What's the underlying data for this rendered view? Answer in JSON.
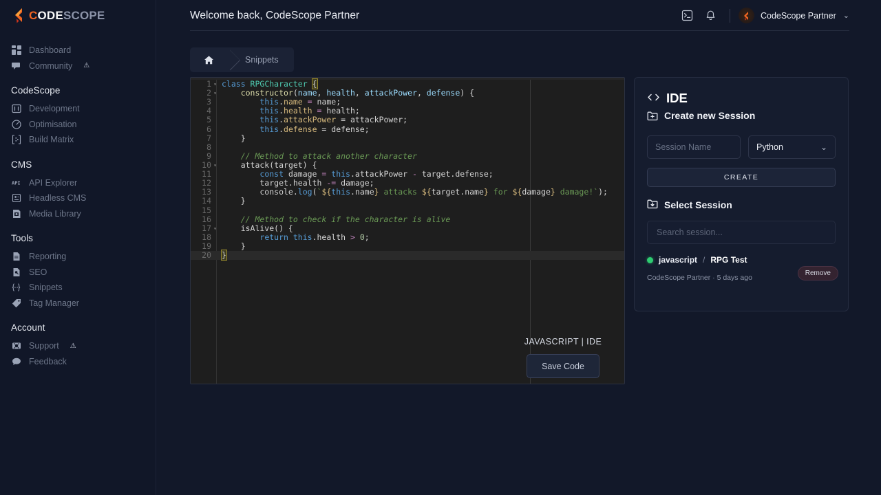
{
  "brand": {
    "part1": "C",
    "part2": "ODE",
    "part3": "SCOPE",
    "accent": "#f26522"
  },
  "sidebar": {
    "groups": [
      {
        "title": "",
        "items": [
          {
            "label": "Dashboard",
            "icon": "dashboard-icon",
            "warn": ""
          },
          {
            "label": "Community",
            "icon": "community-icon",
            "warn": "⚠"
          }
        ]
      },
      {
        "title": "CodeScope",
        "items": [
          {
            "label": "Development",
            "icon": "development-icon",
            "warn": ""
          },
          {
            "label": "Optimisation",
            "icon": "optimisation-icon",
            "warn": ""
          },
          {
            "label": "Build Matrix",
            "icon": "build-matrix-icon",
            "warn": ""
          }
        ]
      },
      {
        "title": "CMS",
        "items": [
          {
            "label": "API Explorer",
            "icon": "api-explorer-icon",
            "warn": ""
          },
          {
            "label": "Headless CMS",
            "icon": "headless-cms-icon",
            "warn": ""
          },
          {
            "label": "Media Library",
            "icon": "media-library-icon",
            "warn": ""
          }
        ]
      },
      {
        "title": "Tools",
        "items": [
          {
            "label": "Reporting",
            "icon": "reporting-icon",
            "warn": ""
          },
          {
            "label": "SEO",
            "icon": "seo-icon",
            "warn": ""
          },
          {
            "label": "Snippets",
            "icon": "snippets-icon",
            "warn": ""
          },
          {
            "label": "Tag Manager",
            "icon": "tag-manager-icon",
            "warn": ""
          }
        ]
      },
      {
        "title": "Account",
        "items": [
          {
            "label": "Support",
            "icon": "support-icon",
            "warn": "⚠"
          },
          {
            "label": "Feedback",
            "icon": "feedback-icon",
            "warn": ""
          }
        ]
      }
    ]
  },
  "header": {
    "welcome": "Welcome back, CodeScope Partner",
    "terminal_icon": "terminal-icon",
    "bell_icon": "bell-icon",
    "user_name": "CodeScope Partner",
    "caret": "⌄"
  },
  "breadcrumb": {
    "home_icon": "home-icon",
    "current": "Snippets"
  },
  "editor": {
    "language_label": "JAVASCRIPT | IDE",
    "save_label": "Save Code",
    "lines": [
      {
        "n": "1",
        "fold": "▾",
        "tokens": [
          {
            "t": "class ",
            "c": "k"
          },
          {
            "t": "RPGCharacter ",
            "c": "cl"
          },
          {
            "t": "{",
            "c": "br-hl"
          }
        ]
      },
      {
        "n": "2",
        "fold": "▾",
        "tokens": [
          {
            "t": "    constructor",
            "c": "fn"
          },
          {
            "t": "(",
            "c": "op"
          },
          {
            "t": "name",
            "c": "id"
          },
          {
            "t": ", ",
            "c": "op"
          },
          {
            "t": "health",
            "c": "id"
          },
          {
            "t": ", ",
            "c": "op"
          },
          {
            "t": "attackPower",
            "c": "id"
          },
          {
            "t": ", ",
            "c": "op"
          },
          {
            "t": "defense",
            "c": "id"
          },
          {
            "t": ") {",
            "c": "op"
          }
        ]
      },
      {
        "n": "3",
        "fold": "",
        "tokens": [
          {
            "t": "        ",
            "c": "op"
          },
          {
            "t": "this",
            "c": "k"
          },
          {
            "t": ".",
            "c": "op"
          },
          {
            "t": "name",
            "c": "yl"
          },
          {
            "t": " ",
            "c": "op"
          },
          {
            "t": "=",
            "c": "pk"
          },
          {
            "t": " name;",
            "c": "op"
          }
        ]
      },
      {
        "n": "4",
        "fold": "",
        "tokens": [
          {
            "t": "        ",
            "c": "op"
          },
          {
            "t": "this",
            "c": "k"
          },
          {
            "t": ".",
            "c": "op"
          },
          {
            "t": "health",
            "c": "yl"
          },
          {
            "t": " ",
            "c": "op"
          },
          {
            "t": "=",
            "c": "pk"
          },
          {
            "t": " health;",
            "c": "op"
          }
        ]
      },
      {
        "n": "5",
        "fold": "",
        "tokens": [
          {
            "t": "        ",
            "c": "op"
          },
          {
            "t": "this",
            "c": "k"
          },
          {
            "t": ".",
            "c": "op"
          },
          {
            "t": "attackPower",
            "c": "yl"
          },
          {
            "t": " = attackPower;",
            "c": "op"
          }
        ]
      },
      {
        "n": "6",
        "fold": "",
        "tokens": [
          {
            "t": "        ",
            "c": "op"
          },
          {
            "t": "this",
            "c": "k"
          },
          {
            "t": ".",
            "c": "op"
          },
          {
            "t": "defense",
            "c": "yl"
          },
          {
            "t": " = defense;",
            "c": "op"
          }
        ]
      },
      {
        "n": "7",
        "fold": "",
        "tokens": [
          {
            "t": "    }",
            "c": "op"
          }
        ]
      },
      {
        "n": "8",
        "fold": "",
        "tokens": [
          {
            "t": "",
            "c": "op"
          }
        ]
      },
      {
        "n": "9",
        "fold": "",
        "tokens": [
          {
            "t": "    // Method to attack another character",
            "c": "cm"
          }
        ]
      },
      {
        "n": "10",
        "fold": "▾",
        "tokens": [
          {
            "t": "    attack",
            "c": "op"
          },
          {
            "t": "(",
            "c": "op"
          },
          {
            "t": "target",
            "c": "op"
          },
          {
            "t": ") {",
            "c": "op"
          }
        ]
      },
      {
        "n": "11",
        "fold": "",
        "tokens": [
          {
            "t": "        ",
            "c": "op"
          },
          {
            "t": "const",
            "c": "k"
          },
          {
            "t": " damage ",
            "c": "op"
          },
          {
            "t": "=",
            "c": "pk"
          },
          {
            "t": " ",
            "c": "op"
          },
          {
            "t": "this",
            "c": "k"
          },
          {
            "t": ".attackPower ",
            "c": "op"
          },
          {
            "t": "-",
            "c": "pk"
          },
          {
            "t": " target.defense;",
            "c": "op"
          }
        ]
      },
      {
        "n": "12",
        "fold": "",
        "tokens": [
          {
            "t": "        target.health ",
            "c": "op"
          },
          {
            "t": "-=",
            "c": "pk"
          },
          {
            "t": " damage;",
            "c": "op"
          }
        ]
      },
      {
        "n": "13",
        "fold": "",
        "tokens": [
          {
            "t": "        console.",
            "c": "op"
          },
          {
            "t": "log",
            "c": "k"
          },
          {
            "t": "(",
            "c": "op"
          },
          {
            "t": "`",
            "c": "tpl"
          },
          {
            "t": "${",
            "c": "yl"
          },
          {
            "t": "this",
            "c": "k"
          },
          {
            "t": ".name",
            "c": "op"
          },
          {
            "t": "}",
            "c": "yl"
          },
          {
            "t": " attacks ",
            "c": "tpl"
          },
          {
            "t": "${",
            "c": "yl"
          },
          {
            "t": "target.name",
            "c": "op"
          },
          {
            "t": "}",
            "c": "yl"
          },
          {
            "t": " for ",
            "c": "tpl"
          },
          {
            "t": "${",
            "c": "yl"
          },
          {
            "t": "damage",
            "c": "op"
          },
          {
            "t": "}",
            "c": "yl"
          },
          {
            "t": " damage!`",
            "c": "tpl"
          },
          {
            "t": ");",
            "c": "op"
          }
        ]
      },
      {
        "n": "14",
        "fold": "",
        "tokens": [
          {
            "t": "    }",
            "c": "op"
          }
        ]
      },
      {
        "n": "15",
        "fold": "",
        "tokens": [
          {
            "t": "",
            "c": "op"
          }
        ]
      },
      {
        "n": "16",
        "fold": "",
        "tokens": [
          {
            "t": "    // Method to check if the character is alive",
            "c": "cm"
          }
        ]
      },
      {
        "n": "17",
        "fold": "▾",
        "tokens": [
          {
            "t": "    isAlive() {",
            "c": "op"
          }
        ]
      },
      {
        "n": "18",
        "fold": "",
        "tokens": [
          {
            "t": "        ",
            "c": "op"
          },
          {
            "t": "return",
            "c": "k"
          },
          {
            "t": " ",
            "c": "op"
          },
          {
            "t": "this",
            "c": "k"
          },
          {
            "t": ".health ",
            "c": "op"
          },
          {
            "t": ">",
            "c": "pk"
          },
          {
            "t": " ",
            "c": "op"
          },
          {
            "t": "0",
            "c": "nm"
          },
          {
            "t": ";",
            "c": "op"
          }
        ]
      },
      {
        "n": "19",
        "fold": "",
        "tokens": [
          {
            "t": "    }",
            "c": "op"
          }
        ]
      },
      {
        "n": "20",
        "fold": "",
        "hl": true,
        "tokens": [
          {
            "t": "}",
            "c": "br-hl"
          }
        ]
      }
    ]
  },
  "ide": {
    "title": "IDE",
    "code_icon": "〈/〉",
    "create_heading": "Create new Session",
    "session_name_placeholder": "Session Name",
    "language_selected": "Python",
    "chevron": "⌄",
    "create_label": "CREATE",
    "select_heading": "Select Session",
    "search_placeholder": "Search session...",
    "sessions": [
      {
        "status": "active",
        "language": "javascript",
        "separator": "/",
        "name": "RPG Test",
        "owner": "CodeScope Partner",
        "dot": "·",
        "time": "5 days ago",
        "remove_label": "Remove"
      }
    ]
  }
}
